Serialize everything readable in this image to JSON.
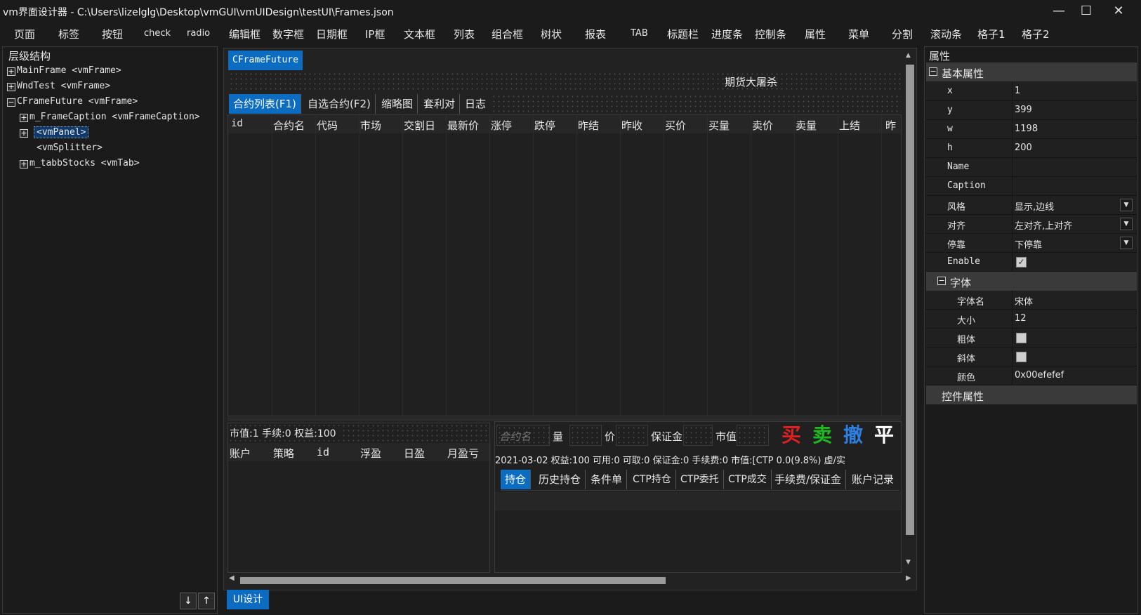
{
  "window": {
    "title": "vm界面设计器 - C:\\Users\\lizelglg\\Desktop\\vmGUI\\vmUIDesign\\testUI\\Frames.json",
    "minimize": "—",
    "maximize": "☐",
    "close": "✕"
  },
  "menu": [
    "页面",
    "标签",
    "按钮",
    "check",
    "radio",
    "编辑框",
    "数字框",
    "日期框",
    "IP框",
    "文本框",
    "列表",
    "组合框",
    "树状",
    "报表",
    "TAB",
    "标题栏",
    "进度条",
    "控制条",
    "属性",
    "菜单",
    "分割",
    "滚动条",
    "格子1",
    "格子2"
  ],
  "tree": {
    "header": "层级结构",
    "nodes": [
      {
        "label": "MainFrame <vmFrame>",
        "exp": "+"
      },
      {
        "label": "WndTest <vmFrame>",
        "exp": "+"
      },
      {
        "label": "CFrameFuture <vmFrame>",
        "exp": "−"
      },
      {
        "label": "m_FrameCaption <vmFrameCaption>",
        "exp": "+"
      },
      {
        "label": "<vmPanel>",
        "exp": "+"
      },
      {
        "label": "<vmSplitter>",
        "exp": ""
      },
      {
        "label": "m_tabbStocks <vmTab>",
        "exp": "+"
      }
    ],
    "down": "↓",
    "up": "↑"
  },
  "design": {
    "frame_tab": "CFrameFuture",
    "frame_title": "期货大屠杀",
    "tabs": [
      "合约列表(F1)",
      "自选合约(F2)",
      "缩略图",
      "套利对",
      "日志"
    ],
    "columns": [
      "id",
      "合约名",
      "代码",
      "市场",
      "交割日",
      "最新价",
      "涨停",
      "跌停",
      "昨结",
      "昨收",
      "买价",
      "买量",
      "卖价",
      "卖量",
      "上结",
      "昨"
    ],
    "left_summary": "市值:1 手续:0 权益:100",
    "left_columns": [
      "账户",
      "策略",
      "id",
      "浮盈",
      "日盈",
      "月盈亏"
    ],
    "order": {
      "placeholder": "合约名",
      "qty": "量",
      "price": "价",
      "margin": "保证金",
      "mkt_value": "市值",
      "buy": "买",
      "sell": "卖",
      "cancel": "撤",
      "close": "平"
    },
    "status_line": "2021-03-02 权益:100 可用:0 可取:0 保证金:0 手续费:0 市值:[CTP 0.0(9.8%) 虚/实",
    "sub_tabs": [
      "持仓",
      "历史持仓",
      "条件单",
      "CTP持仓",
      "CTP委托",
      "CTP成交",
      "手续费/保证金",
      "账户记录"
    ],
    "bottom_tab": "UI设计"
  },
  "props": {
    "header": "属性",
    "basic_group": "基本属性",
    "rows": [
      {
        "key": "x",
        "val": "1"
      },
      {
        "key": "y",
        "val": "399"
      },
      {
        "key": "w",
        "val": "1198"
      },
      {
        "key": "h",
        "val": "200"
      },
      {
        "key": "Name",
        "val": ""
      },
      {
        "key": "Caption",
        "val": ""
      },
      {
        "key": "风格",
        "val": "显示,边线"
      },
      {
        "key": "对齐",
        "val": "左对齐,上对齐"
      },
      {
        "key": "停靠",
        "val": "下停靠"
      },
      {
        "key": "Enable",
        "val": ""
      }
    ],
    "font_group": "字体",
    "font_rows": [
      {
        "key": "字体名",
        "val": "宋体"
      },
      {
        "key": "大小",
        "val": "12"
      },
      {
        "key": "粗体",
        "val": ""
      },
      {
        "key": "斜体",
        "val": ""
      },
      {
        "key": "颜色",
        "val": "0x00efefef"
      }
    ],
    "ctrl_group": "控件属性"
  },
  "colors": {
    "accent": "#0b6cc2",
    "buy": "#e02020",
    "sell": "#1fb81f",
    "cancel": "#2d7fe0",
    "close": "#ffffff"
  }
}
